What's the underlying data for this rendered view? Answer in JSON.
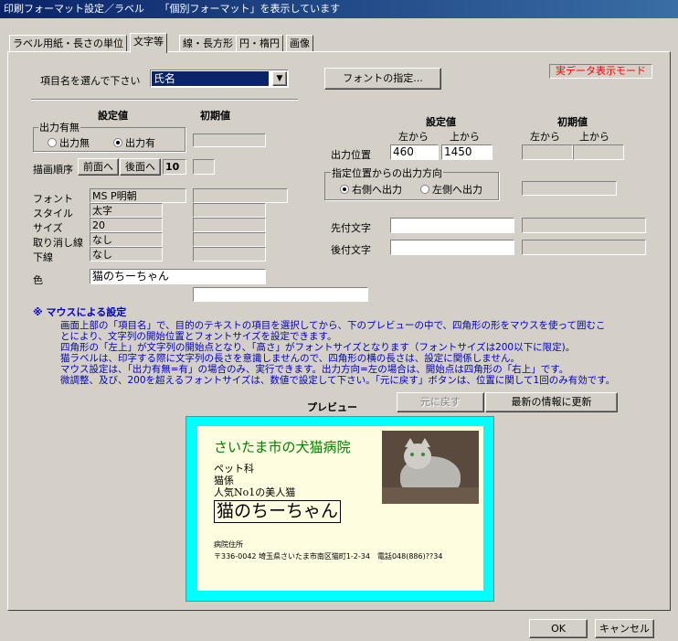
{
  "window": {
    "title": "印刷フォーマット設定／ラベル　　「個別フォーマット」を表示しています"
  },
  "tabs": [
    "ラベル用紙・長さの単位",
    "文字等",
    "線・長方形",
    "円・楕円",
    "画像"
  ],
  "item_select": {
    "label": "項目名を選んで下さい",
    "value": "氏名"
  },
  "font_button": "フォントの指定...",
  "mode_badge": "実データ表示モード",
  "left": {
    "settings_header": "設定値",
    "initial_header": "初期値",
    "output_group": "出力有無",
    "output_off": "出力無",
    "output_on": "出力有",
    "draw_order_label": "描画順序",
    "front_btn": "前面へ",
    "back_btn": "後面へ",
    "draw_order_value": "10",
    "font_label": "フォント",
    "font_value": "MS P明朝",
    "style_label": "スタイル",
    "style_value": "太字",
    "size_label": "サイズ",
    "size_value": "20",
    "strike_label": "取り消し線",
    "strike_value": "なし",
    "underline_label": "下線",
    "underline_value": "なし",
    "color_label": "色",
    "color_text": "猫のちーちゃん"
  },
  "right": {
    "settings_header": "設定値",
    "initial_header": "初期値",
    "from_left": "左から",
    "from_top": "上から",
    "init_from_left": "左から",
    "init_from_top": "上から",
    "position_label": "出力位置",
    "pos_left": "460",
    "pos_top": "1450",
    "direction_group": "指定位置からの出力方向",
    "dir_right": "右側へ出力",
    "dir_left": "左側へ出力",
    "prefix_label": "先付文字",
    "prefix_value": "",
    "suffix_label": "後付文字",
    "suffix_value": ""
  },
  "help": {
    "title": "※ マウスによる設定",
    "lines": [
      "画面上部の「項目名」で、目的のテキストの項目を選択してから、下のプレビューの中で、四角形の形をマウスを使って囲むこ",
      "とにより、文字列の開始位置とフォントサイズを設定できます。",
      "四角形の「左上」が文字列の開始点となり、「高さ」がフォントサイズとなります（フォントサイズは200以下に限定)。",
      "猫ラベルは、印字する際に文字列の長さを意識しませんので、四角形の横の長さは、設定に関係しません。",
      "マウス設定は、「出力有無=有」の場合のみ、実行できます。出力方向=左の場合は、開始点は四角形の「右上」です。",
      "微調整、及び、200を超えるフォントサイズは、数値で設定して下さい。「元に戻す」ボタンは、位置に関して1回のみ有効です。"
    ]
  },
  "preview": {
    "label": "プレビュー",
    "undo_btn": "元に戻す",
    "refresh_btn": "最新の情報に更新",
    "clinic": "さいたま市の犬猫病院",
    "dept": "ペット科",
    "role": "猫係",
    "tagline": "人気No1の美人猫",
    "name": "猫のちーちゃん",
    "addr_label": "病院住所",
    "addr": "〒336-0042 埼玉県さいたま市南区猫町1-2-34　電話048(886)??34",
    "accent": "#00ffff",
    "clinic_color": "#008000"
  },
  "footer": {
    "ok": "OK",
    "cancel": "キャンセル"
  }
}
